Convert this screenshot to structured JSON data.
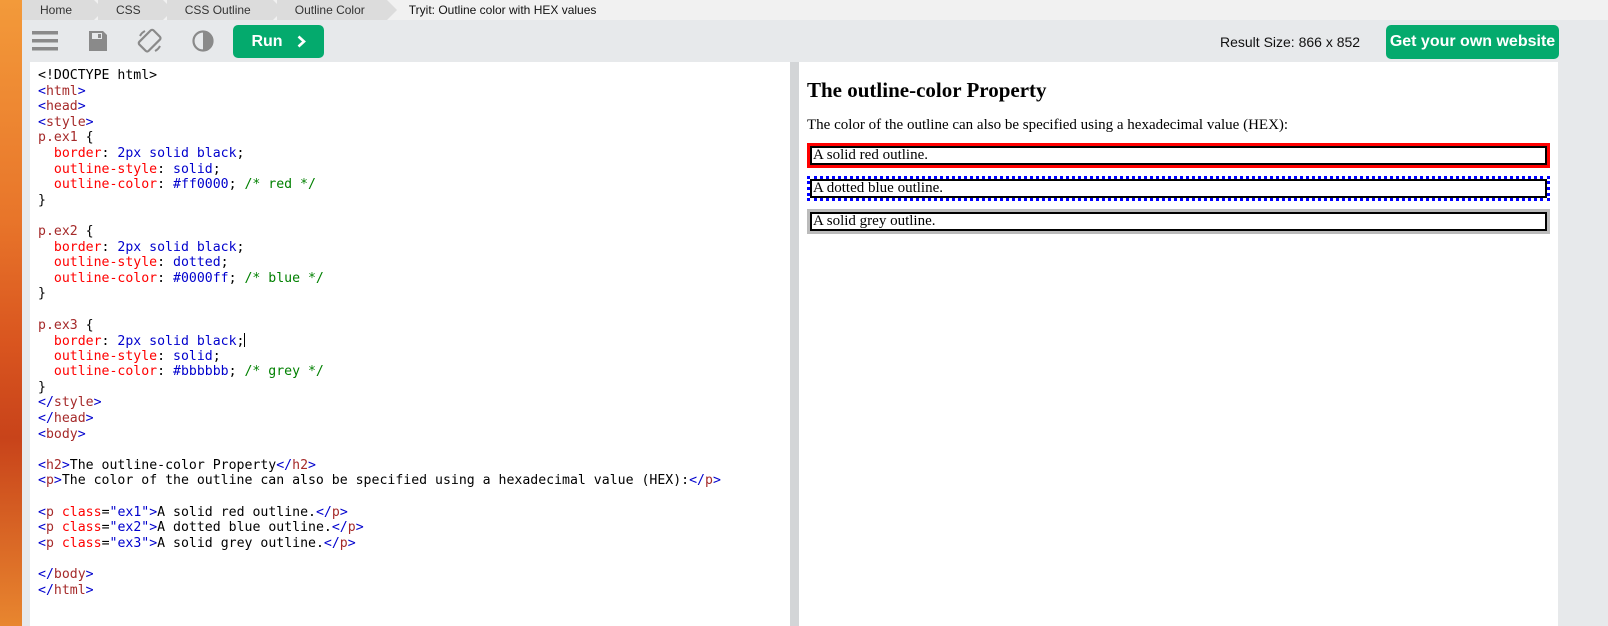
{
  "breadcrumb": [
    "Home",
    "CSS",
    "CSS Outline",
    "Outline Color",
    "Tryit: Outline color with HEX values"
  ],
  "toolbar": {
    "icons": [
      "menu-icon",
      "save-icon",
      "rotate-icon",
      "contrast-icon"
    ],
    "run_label": "Run",
    "result_size": "Result Size: 866 x 852",
    "get_website_label": "Get your own website"
  },
  "colors": {
    "accent_green": "#04aa6d",
    "code_tag": "#0000cd",
    "code_name": "#a52a2a",
    "code_attr": "#ff0000",
    "code_comment": "#008000"
  },
  "editor": {
    "lines": [
      "<!DOCTYPE html>",
      "<html>",
      "<head>",
      "<style>",
      "p.ex1 {",
      "  border: 2px solid black;",
      "  outline-style: solid;",
      "  outline-color: #ff0000; /* red */",
      "}",
      "",
      "p.ex2 {",
      "  border: 2px solid black;",
      "  outline-style: dotted;",
      "  outline-color: #0000ff; /* blue */",
      "}",
      "",
      "p.ex3 {",
      "  border: 2px solid black;",
      "  outline-style: solid;",
      "  outline-color: #bbbbbb; /* grey */",
      "}",
      "</style>",
      "</head>",
      "<body>",
      "",
      "<h2>The outline-color Property</h2>",
      "<p>The color of the outline can also be specified using a hexadecimal value (HEX):</p>",
      "",
      "<p class=\"ex1\">A solid red outline.</p>",
      "<p class=\"ex2\">A dotted blue outline.</p>",
      "<p class=\"ex3\">A solid grey outline.</p>",
      "",
      "</body>",
      "</html>"
    ]
  },
  "result": {
    "heading": "The outline-color Property",
    "intro": "The color of the outline can also be specified using a hexadecimal value (HEX):",
    "examples": [
      {
        "text": "A solid red outline.",
        "outline_color": "#ff0000",
        "style": "solid"
      },
      {
        "text": "A dotted blue outline.",
        "outline_color": "#0000ff",
        "style": "dotted"
      },
      {
        "text": "A solid grey outline.",
        "outline_color": "#bbbbbb",
        "style": "solid"
      }
    ]
  }
}
